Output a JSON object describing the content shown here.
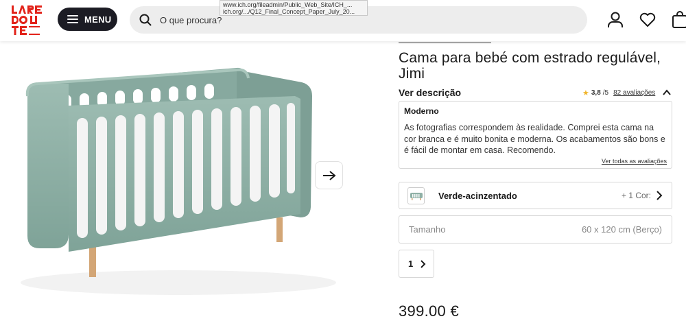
{
  "header": {
    "logo_text": "LA REDOUTE",
    "menu_label": "MENU",
    "search_placeholder": "O que procura?"
  },
  "tooltip": {
    "line1": "www.ich.org/fileadmin/Public_Web_Site/ICH_...",
    "line2": "ich.org/.../Q12_Final_Concept_Paper_July_20..."
  },
  "product": {
    "title": "Cama para bebé com estrado regulável, Jimi",
    "description_link": "Ver descrição",
    "rating": {
      "score": "3,8",
      "out_of": "/5",
      "reviews": "82 avaliações"
    },
    "review": {
      "title": "Moderno",
      "text": "As fotografias correspondem às realidade. Comprei esta cama na cor branca e é muito bonita e moderna. Os acabamentos são bons e é fácil de montar em casa. Recomendo.",
      "see_all": "Ver todas as avaliações"
    },
    "color": {
      "name": "Verde-acinzentado",
      "more": "+ 1 Cor:"
    },
    "size": {
      "label": "Tamanho",
      "value": "60 x 120 cm (Berço)"
    },
    "quantity": "1",
    "price": "399.00 €"
  },
  "colors": {
    "accent_red": "#e2231a",
    "menu_bg": "#1c1c24",
    "crib_green": "#8fb0a6",
    "star": "#f0b429"
  }
}
